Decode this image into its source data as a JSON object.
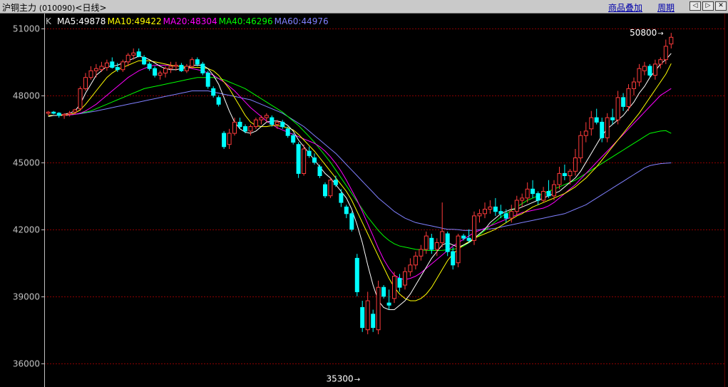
{
  "header": {
    "title": "沪铜主力",
    "code": "(010090)",
    "period": "<日线>",
    "overlay_label": "商品叠加",
    "cycle_label": "周期",
    "nav_prev_glyph": "◁",
    "nav_next_glyph": "▷",
    "nav_close_glyph": "✕"
  },
  "colors": {
    "background": "#000000",
    "up": "#ff3b3b",
    "down": "#00ffff",
    "grid": "#8b0000",
    "axis": "#c0c0c0",
    "ma5": "#ffffff",
    "ma10": "#ffff00",
    "ma20": "#ff00ff",
    "ma40": "#00ff00",
    "ma60": "#8080ff"
  },
  "chart_data": {
    "type": "candlestick",
    "kind_label": "K",
    "yticks": [
      36000,
      39000,
      42000,
      45000,
      48000,
      51000
    ],
    "ylim": [
      35000,
      51600
    ],
    "grid": true,
    "legend": [
      {
        "key": "ma5",
        "label": "MA5:49878"
      },
      {
        "key": "ma10",
        "label": "MA10:49422"
      },
      {
        "key": "ma20",
        "label": "MA20:48304"
      },
      {
        "key": "ma40",
        "label": "MA40:46296"
      },
      {
        "key": "ma60",
        "label": "MA60:44976"
      }
    ],
    "annotations": {
      "high": {
        "value": 50800,
        "label": "50800"
      },
      "low": {
        "value": 35300,
        "label": "35300"
      }
    },
    "candles": [
      [
        47200,
        47300,
        47100,
        47250
      ],
      [
        47250,
        47300,
        47150,
        47200
      ],
      [
        47200,
        47250,
        47000,
        47100
      ],
      [
        47100,
        47200,
        46950,
        47150
      ],
      [
        47150,
        47300,
        47050,
        47200
      ],
      [
        47250,
        47400,
        47150,
        47350
      ],
      [
        47400,
        48400,
        47300,
        48300
      ],
      [
        48300,
        49000,
        48200,
        48800
      ],
      [
        48800,
        49300,
        48700,
        49100
      ],
      [
        49100,
        49400,
        48800,
        49200
      ],
      [
        49150,
        49500,
        49050,
        49300
      ],
      [
        49250,
        49600,
        49100,
        49450
      ],
      [
        49500,
        49700,
        49200,
        49250
      ],
      [
        49250,
        49450,
        49050,
        49150
      ],
      [
        49150,
        49600,
        49050,
        49500
      ],
      [
        49500,
        49900,
        49300,
        49800
      ],
      [
        49800,
        50100,
        49600,
        49900
      ],
      [
        49950,
        50100,
        49700,
        49750
      ],
      [
        49700,
        49800,
        49350,
        49400
      ],
      [
        49400,
        49500,
        49100,
        49200
      ],
      [
        49200,
        49300,
        48800,
        48900
      ],
      [
        48900,
        49100,
        48700,
        49000
      ],
      [
        49000,
        49300,
        48800,
        49200
      ],
      [
        49200,
        49500,
        49000,
        49300
      ],
      [
        49300,
        49500,
        49100,
        49350
      ],
      [
        49350,
        49450,
        49050,
        49100
      ],
      [
        49100,
        49400,
        49000,
        49300
      ],
      [
        49300,
        49700,
        49200,
        49600
      ],
      [
        49600,
        49700,
        49300,
        49400
      ],
      [
        49400,
        49500,
        48900,
        49000
      ],
      [
        49000,
        49100,
        48300,
        48400
      ],
      [
        48300,
        48400,
        47900,
        48000
      ],
      [
        47900,
        48000,
        47500,
        47600
      ],
      [
        46300,
        46400,
        45600,
        45700
      ],
      [
        45800,
        46500,
        45600,
        46300
      ],
      [
        46300,
        47000,
        46200,
        46800
      ],
      [
        46800,
        47000,
        46500,
        46600
      ],
      [
        46600,
        46700,
        46300,
        46400
      ],
      [
        46400,
        46700,
        46200,
        46600
      ],
      [
        46600,
        47000,
        46500,
        46900
      ],
      [
        46900,
        47100,
        46700,
        47000
      ],
      [
        47000,
        47200,
        46800,
        47100
      ],
      [
        47000,
        47100,
        46600,
        46700
      ],
      [
        46700,
        46900,
        46500,
        46800
      ],
      [
        46800,
        46900,
        46500,
        46600
      ],
      [
        46500,
        46600,
        46100,
        46200
      ],
      [
        46200,
        46300,
        45800,
        45900
      ],
      [
        45800,
        45900,
        44300,
        44500
      ],
      [
        44500,
        45800,
        44400,
        45600
      ],
      [
        45500,
        45700,
        45200,
        45300
      ],
      [
        45200,
        45400,
        44900,
        45000
      ],
      [
        44800,
        44900,
        44300,
        44400
      ],
      [
        44000,
        44100,
        43400,
        43500
      ],
      [
        43500,
        44300,
        43400,
        44200
      ],
      [
        44200,
        44400,
        43900,
        44000
      ],
      [
        43600,
        43800,
        43000,
        43200
      ],
      [
        43000,
        43100,
        42500,
        42700
      ],
      [
        42700,
        42800,
        41900,
        42000
      ],
      [
        40700,
        40900,
        39000,
        39200
      ],
      [
        38500,
        38800,
        37400,
        37600
      ],
      [
        37500,
        39200,
        37300,
        38800
      ],
      [
        38200,
        38400,
        37400,
        37600
      ],
      [
        37500,
        39700,
        37300,
        39400
      ],
      [
        39400,
        39500,
        38900,
        39000
      ],
      [
        38700,
        39300,
        38400,
        38600
      ],
      [
        38900,
        40100,
        38700,
        39900
      ],
      [
        39800,
        40000,
        39200,
        39400
      ],
      [
        39500,
        40300,
        39300,
        40100
      ],
      [
        40100,
        40700,
        39900,
        40400
      ],
      [
        40400,
        41000,
        40200,
        40800
      ],
      [
        40800,
        41300,
        40600,
        41100
      ],
      [
        41100,
        41900,
        40900,
        41700
      ],
      [
        41600,
        41800,
        40900,
        41100
      ],
      [
        41100,
        41600,
        40800,
        41400
      ],
      [
        41400,
        43200,
        41200,
        41900
      ],
      [
        41800,
        41900,
        40800,
        41000
      ],
      [
        41000,
        41200,
        40200,
        40400
      ],
      [
        40500,
        41800,
        40300,
        41700
      ],
      [
        41700,
        41800,
        41500,
        41600
      ],
      [
        41600,
        42000,
        41400,
        41500
      ],
      [
        41500,
        42800,
        41300,
        42600
      ],
      [
        42600,
        42900,
        42300,
        42700
      ],
      [
        42700,
        43200,
        42500,
        42900
      ],
      [
        42900,
        43300,
        42700,
        43000
      ],
      [
        43000,
        43400,
        42600,
        42800
      ],
      [
        42800,
        43100,
        42500,
        42700
      ],
      [
        42700,
        42900,
        42300,
        42500
      ],
      [
        42500,
        43100,
        42300,
        42800
      ],
      [
        42800,
        43500,
        42600,
        43300
      ],
      [
        43300,
        43600,
        43000,
        43400
      ],
      [
        43400,
        44100,
        43200,
        43800
      ],
      [
        43800,
        44200,
        43400,
        43600
      ],
      [
        43600,
        43700,
        43100,
        43300
      ],
      [
        43300,
        43900,
        43200,
        43700
      ],
      [
        43700,
        44200,
        43400,
        43500
      ],
      [
        43500,
        44200,
        43300,
        44000
      ],
      [
        44000,
        44800,
        43800,
        44500
      ],
      [
        44500,
        44900,
        44200,
        44400
      ],
      [
        44400,
        44700,
        44000,
        44600
      ],
      [
        44600,
        45600,
        44400,
        45200
      ],
      [
        45200,
        46400,
        45000,
        46200
      ],
      [
        46200,
        46800,
        45900,
        46400
      ],
      [
        46500,
        47300,
        46200,
        47000
      ],
      [
        47000,
        47400,
        46700,
        46800
      ],
      [
        46800,
        47000,
        45900,
        46100
      ],
      [
        46100,
        47200,
        45900,
        47000
      ],
      [
        47000,
        47400,
        46700,
        46900
      ],
      [
        46900,
        48200,
        46700,
        47900
      ],
      [
        47900,
        48100,
        47300,
        47500
      ],
      [
        47500,
        48500,
        47300,
        48300
      ],
      [
        48300,
        48800,
        48000,
        48600
      ],
      [
        48600,
        49400,
        48400,
        49200
      ],
      [
        49100,
        49500,
        48900,
        49300
      ],
      [
        49300,
        49400,
        48800,
        48900
      ],
      [
        48900,
        49600,
        48700,
        49400
      ],
      [
        49400,
        49700,
        49200,
        49600
      ],
      [
        49600,
        50500,
        49400,
        50200
      ],
      [
        50300,
        50800,
        50100,
        50600
      ]
    ],
    "ma5": [
      47050,
      47100,
      47100,
      47150,
      47200,
      47300,
      47600,
      48100,
      48500,
      48900,
      49100,
      49300,
      49300,
      49350,
      49450,
      49550,
      49650,
      49750,
      49700,
      49600,
      49450,
      49300,
      49200,
      49150,
      49150,
      49200,
      49250,
      49350,
      49350,
      49350,
      49200,
      48900,
      48500,
      47900,
      47300,
      46800,
      46500,
      46350,
      46300,
      46400,
      46600,
      46800,
      46850,
      46850,
      46800,
      46650,
      46400,
      46000,
      45700,
      45400,
      45100,
      44800,
      44500,
      44300,
      44000,
      43700,
      43400,
      42900,
      42200,
      41400,
      40400,
      39500,
      38800,
      38500,
      38400,
      38400,
      38600,
      38800,
      39100,
      39500,
      39900,
      40300,
      40700,
      41000,
      41300,
      41400,
      41300,
      41200,
      41300,
      41400,
      41600,
      41800,
      42000,
      42300,
      42500,
      42700,
      42800,
      42900,
      42900,
      43000,
      43100,
      43200,
      43300,
      43400,
      43500,
      43600,
      43700,
      43900,
      44100,
      44300,
      44600,
      45000,
      45400,
      45800,
      46200,
      46500,
      46700,
      46900,
      47100,
      47400,
      47700,
      48100,
      48400,
      48800,
      49100,
      49400,
      49600,
      49878
    ],
    "ma10": [
      47100,
      47100,
      47100,
      47100,
      47150,
      47200,
      47350,
      47600,
      47900,
      48200,
      48500,
      48800,
      49000,
      49150,
      49250,
      49350,
      49450,
      49550,
      49550,
      49550,
      49500,
      49450,
      49400,
      49350,
      49300,
      49300,
      49250,
      49250,
      49250,
      49250,
      49200,
      49100,
      48900,
      48600,
      48300,
      47900,
      47500,
      47100,
      46800,
      46650,
      46600,
      46600,
      46650,
      46650,
      46600,
      46550,
      46450,
      46250,
      46000,
      45750,
      45500,
      45200,
      44900,
      44600,
      44300,
      44000,
      43700,
      43300,
      42800,
      42300,
      41800,
      41300,
      40800,
      40300,
      39800,
      39400,
      39100,
      38900,
      38800,
      38800,
      38900,
      39100,
      39400,
      39800,
      40200,
      40600,
      40900,
      41100,
      41300,
      41450,
      41600,
      41700,
      41800,
      41900,
      42000,
      42150,
      42300,
      42450,
      42600,
      42700,
      42850,
      43000,
      43100,
      43200,
      43300,
      43400,
      43500,
      43600,
      43750,
      43900,
      44100,
      44300,
      44550,
      44800,
      45100,
      45400,
      45700,
      46000,
      46300,
      46600,
      46900,
      47200,
      47550,
      47900,
      48250,
      48600,
      48950,
      49422
    ],
    "ma20": [
      47100,
      47100,
      47100,
      47100,
      47120,
      47150,
      47200,
      47300,
      47450,
      47600,
      47800,
      48000,
      48200,
      48400,
      48600,
      48800,
      48950,
      49100,
      49200,
      49300,
      49350,
      49350,
      49350,
      49350,
      49300,
      49300,
      49250,
      49200,
      49150,
      49100,
      49000,
      48900,
      48750,
      48600,
      48400,
      48200,
      47950,
      47700,
      47450,
      47250,
      47050,
      46850,
      46700,
      46550,
      46450,
      46350,
      46250,
      46150,
      46050,
      45950,
      45850,
      45700,
      45500,
      45250,
      44950,
      44600,
      44200,
      43750,
      43300,
      42800,
      42250,
      41700,
      41150,
      40650,
      40250,
      39950,
      39800,
      39750,
      39800,
      39900,
      40050,
      40250,
      40450,
      40650,
      40850,
      41050,
      41250,
      41400,
      41550,
      41700,
      41850,
      41950,
      42050,
      42150,
      42250,
      42350,
      42450,
      42550,
      42650,
      42750,
      42800,
      42850,
      42900,
      42950,
      43050,
      43200,
      43400,
      43600,
      43800,
      44000,
      44250,
      44500,
      44750,
      45000,
      45250,
      45500,
      45750,
      46000,
      46250,
      46500,
      46750,
      47000,
      47250,
      47500,
      47750,
      48000,
      48150,
      48304
    ],
    "ma40": [
      47100,
      47100,
      47100,
      47100,
      47120,
      47150,
      47200,
      47250,
      47300,
      47400,
      47500,
      47600,
      47700,
      47800,
      47900,
      48000,
      48100,
      48200,
      48300,
      48350,
      48400,
      48450,
      48500,
      48550,
      48600,
      48650,
      48700,
      48750,
      48800,
      48800,
      48800,
      48800,
      48750,
      48700,
      48600,
      48500,
      48400,
      48300,
      48150,
      48000,
      47850,
      47700,
      47550,
      47400,
      47250,
      47050,
      46850,
      46650,
      46400,
      46150,
      45900,
      45600,
      45300,
      45000,
      44650,
      44300,
      43950,
      43600,
      43250,
      42900,
      42550,
      42250,
      41950,
      41700,
      41500,
      41350,
      41250,
      41200,
      41150,
      41100,
      41080,
      41060,
      41050,
      41050,
      41060,
      41080,
      41100,
      41150,
      41250,
      41400,
      41550,
      41750,
      41950,
      42150,
      42350,
      42550,
      42700,
      42850,
      43000,
      43150,
      43300,
      43400,
      43500,
      43600,
      43700,
      43800,
      43900,
      44000,
      44100,
      44200,
      44350,
      44500,
      44650,
      44800,
      44950,
      45100,
      45250,
      45400,
      45550,
      45700,
      45850,
      46000,
      46150,
      46296,
      46350,
      46400,
      46420,
      46296
    ],
    "ma60": [
      47100,
      47100,
      47100,
      47100,
      47120,
      47150,
      47180,
      47220,
      47260,
      47300,
      47350,
      47400,
      47450,
      47500,
      47550,
      47600,
      47650,
      47700,
      47750,
      47800,
      47850,
      47900,
      47950,
      48000,
      48050,
      48100,
      48150,
      48200,
      48200,
      48200,
      48200,
      48150,
      48100,
      48050,
      48000,
      47950,
      47900,
      47850,
      47800,
      47700,
      47600,
      47500,
      47400,
      47300,
      47200,
      47050,
      46900,
      46750,
      46600,
      46400,
      46200,
      46000,
      45800,
      45600,
      45400,
      45150,
      44900,
      44650,
      44400,
      44150,
      43900,
      43650,
      43400,
      43200,
      43000,
      42800,
      42650,
      42500,
      42400,
      42300,
      42250,
      42200,
      42150,
      42100,
      42050,
      42000,
      42000,
      41980,
      41950,
      41950,
      41950,
      41980,
      42000,
      42020,
      42050,
      42100,
      42150,
      42200,
      42250,
      42300,
      42350,
      42400,
      42450,
      42500,
      42550,
      42600,
      42650,
      42700,
      42800,
      42900,
      43000,
      43100,
      43250,
      43400,
      43550,
      43700,
      43850,
      44000,
      44150,
      44300,
      44450,
      44600,
      44750,
      44850,
      44900,
      44940,
      44960,
      44976
    ]
  }
}
